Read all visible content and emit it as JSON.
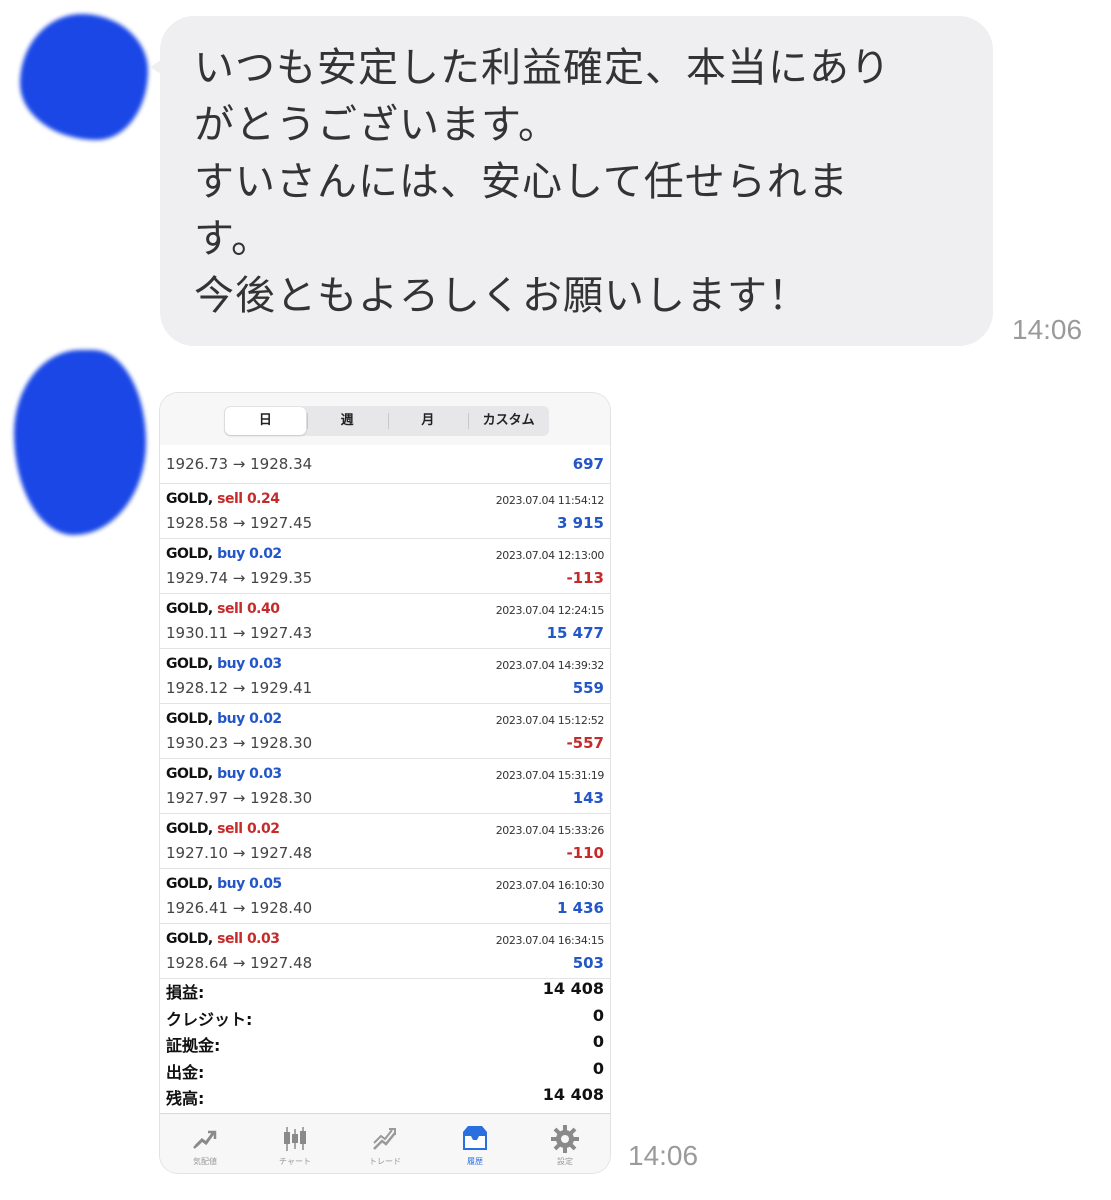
{
  "chat": {
    "message_1": {
      "lines": [
        "いつも安定した利益確定、本当にあり",
        "がとうございます。",
        "すいさんには、安心して任せられま",
        "す。",
        "今後ともよろしくお願いします！"
      ],
      "time": "14:06"
    },
    "message_2": {
      "time": "14:06"
    }
  },
  "screenshot": {
    "segments": [
      "日",
      "週",
      "月",
      "カスタム"
    ],
    "selected_segment": "日",
    "trades": [
      {
        "prices": "1926.73 → 1928.34",
        "profit": "697",
        "profit_sign": "pos"
      },
      {
        "symbol": "GOLD,",
        "side": "sell",
        "volume": "sell 0.24",
        "datetime": "2023.07.04 11:54:12",
        "prices": "1928.58 → 1927.45",
        "profit": "3 915",
        "profit_sign": "pos"
      },
      {
        "symbol": "GOLD,",
        "side": "buy",
        "volume": "buy 0.02",
        "datetime": "2023.07.04 12:13:00",
        "prices": "1929.74 → 1929.35",
        "profit": "-113",
        "profit_sign": "neg"
      },
      {
        "symbol": "GOLD,",
        "side": "sell",
        "volume": "sell 0.40",
        "datetime": "2023.07.04 12:24:15",
        "prices": "1930.11 → 1927.43",
        "profit": "15 477",
        "profit_sign": "pos"
      },
      {
        "symbol": "GOLD,",
        "side": "buy",
        "volume": "buy 0.03",
        "datetime": "2023.07.04 14:39:32",
        "prices": "1928.12 → 1929.41",
        "profit": "559",
        "profit_sign": "pos"
      },
      {
        "symbol": "GOLD,",
        "side": "buy",
        "volume": "buy 0.02",
        "datetime": "2023.07.04 15:12:52",
        "prices": "1930.23 → 1928.30",
        "profit": "-557",
        "profit_sign": "neg"
      },
      {
        "symbol": "GOLD,",
        "side": "buy",
        "volume": "buy 0.03",
        "datetime": "2023.07.04 15:31:19",
        "prices": "1927.97 → 1928.30",
        "profit": "143",
        "profit_sign": "pos"
      },
      {
        "symbol": "GOLD,",
        "side": "sell",
        "volume": "sell 0.02",
        "datetime": "2023.07.04 15:33:26",
        "prices": "1927.10 → 1927.48",
        "profit": "-110",
        "profit_sign": "neg"
      },
      {
        "symbol": "GOLD,",
        "side": "buy",
        "volume": "buy 0.05",
        "datetime": "2023.07.04 16:10:30",
        "prices": "1926.41 → 1928.40",
        "profit": "1 436",
        "profit_sign": "pos"
      },
      {
        "symbol": "GOLD,",
        "side": "sell",
        "volume": "sell 0.03",
        "datetime": "2023.07.04 16:34:15",
        "prices": "1928.64 → 1927.48",
        "profit": "503",
        "profit_sign": "pos"
      }
    ],
    "summary": [
      {
        "label": "損益:",
        "value": "14 408"
      },
      {
        "label": "クレジット:",
        "value": "0"
      },
      {
        "label": "証拠金:",
        "value": "0"
      },
      {
        "label": "出金:",
        "value": "0"
      },
      {
        "label": "残高:",
        "value": "14 408"
      }
    ],
    "tabs": [
      {
        "icon": "quotes-icon",
        "label": "気配値"
      },
      {
        "icon": "candlestick-chart-icon",
        "label": "チャート"
      },
      {
        "icon": "trade-icon",
        "label": "トレード"
      },
      {
        "icon": "history-inbox-icon",
        "label": "履歴",
        "active": true
      },
      {
        "icon": "gear-icon",
        "label": "設定"
      }
    ]
  },
  "colors": {
    "bubble_bg": "#efeff1",
    "avatar_blot": "#1a47e6",
    "sell": "#c42b2b",
    "buy": "#2356c7",
    "active_tab": "#2a6fe0"
  }
}
